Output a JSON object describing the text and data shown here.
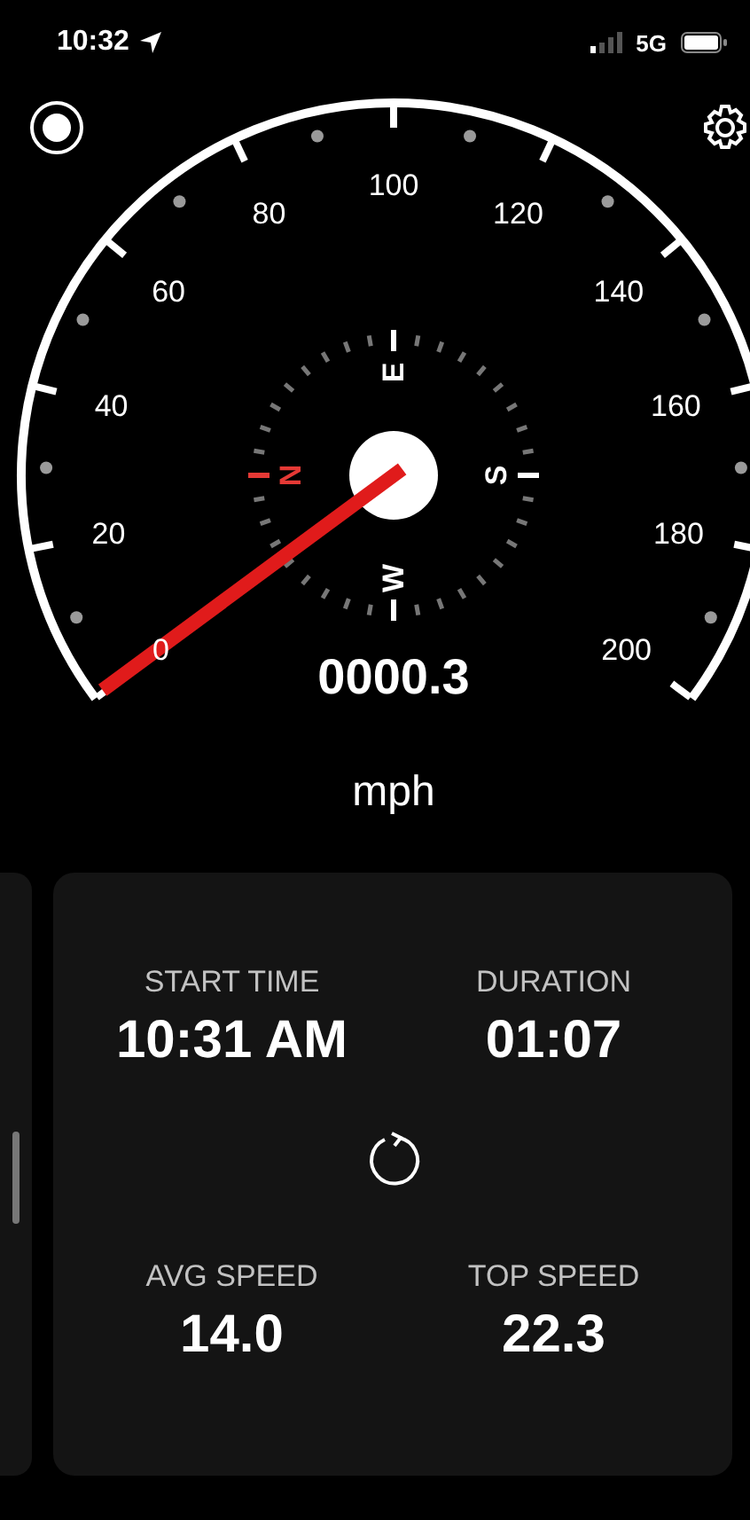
{
  "status_bar": {
    "time": "10:32",
    "network": "5G"
  },
  "gauge": {
    "scale_labels": [
      "0",
      "20",
      "40",
      "60",
      "80",
      "100",
      "120",
      "140",
      "160",
      "180",
      "200"
    ],
    "compass": [
      {
        "label": "N",
        "color": "#e53935"
      },
      {
        "label": "E",
        "color": "#ffffff"
      },
      {
        "label": "S",
        "color": "#ffffff"
      },
      {
        "label": "W",
        "color": "#ffffff"
      }
    ],
    "speed": "0000.3",
    "unit": "mph"
  },
  "stats": [
    {
      "label": "START TIME",
      "value": "10:31 AM"
    },
    {
      "label": "DURATION",
      "value": "01:07"
    },
    {
      "label": "AVG SPEED",
      "value": "14.0"
    },
    {
      "label": "TOP SPEED",
      "value": "22.3"
    }
  ]
}
